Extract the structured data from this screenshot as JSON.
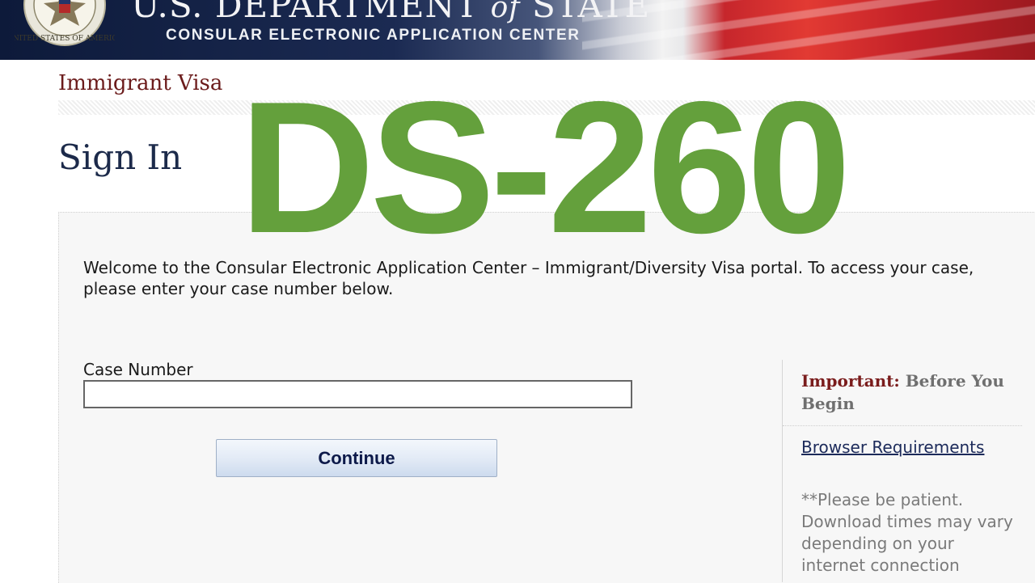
{
  "banner": {
    "department_prefix": "U.S. DEPARTMENT ",
    "department_of": "of",
    "department_suffix": " STATE",
    "subtitle": "CONSULAR ELECTRONIC APPLICATION CENTER",
    "seal_icon": "us-department-of-state-seal",
    "seal_text": "UNITED STATES OF AMERICA"
  },
  "page": {
    "visa_type": "Immigrant Visa",
    "title": "Sign In"
  },
  "form": {
    "welcome_text": "Welcome to the Consular Electronic Application Center – Immigrant/Diversity Visa portal. To access your case, please enter your case number below.",
    "case_number_label": "Case Number",
    "case_number_value": "",
    "continue_label": "Continue"
  },
  "sidebar": {
    "important_label": "Important:",
    "important_rest": " Before You Begin",
    "browser_requirements_link": "Browser Requirements",
    "patient_note": "**Please be patient. Download times may vary depending on your internet connection"
  },
  "overlay": {
    "text": "DS-260"
  },
  "colors": {
    "overlay_green": "#64a03c",
    "visa_type_red": "#6b1b1b",
    "title_navy": "#1c2a4a",
    "link_navy": "#1c2a5a"
  }
}
